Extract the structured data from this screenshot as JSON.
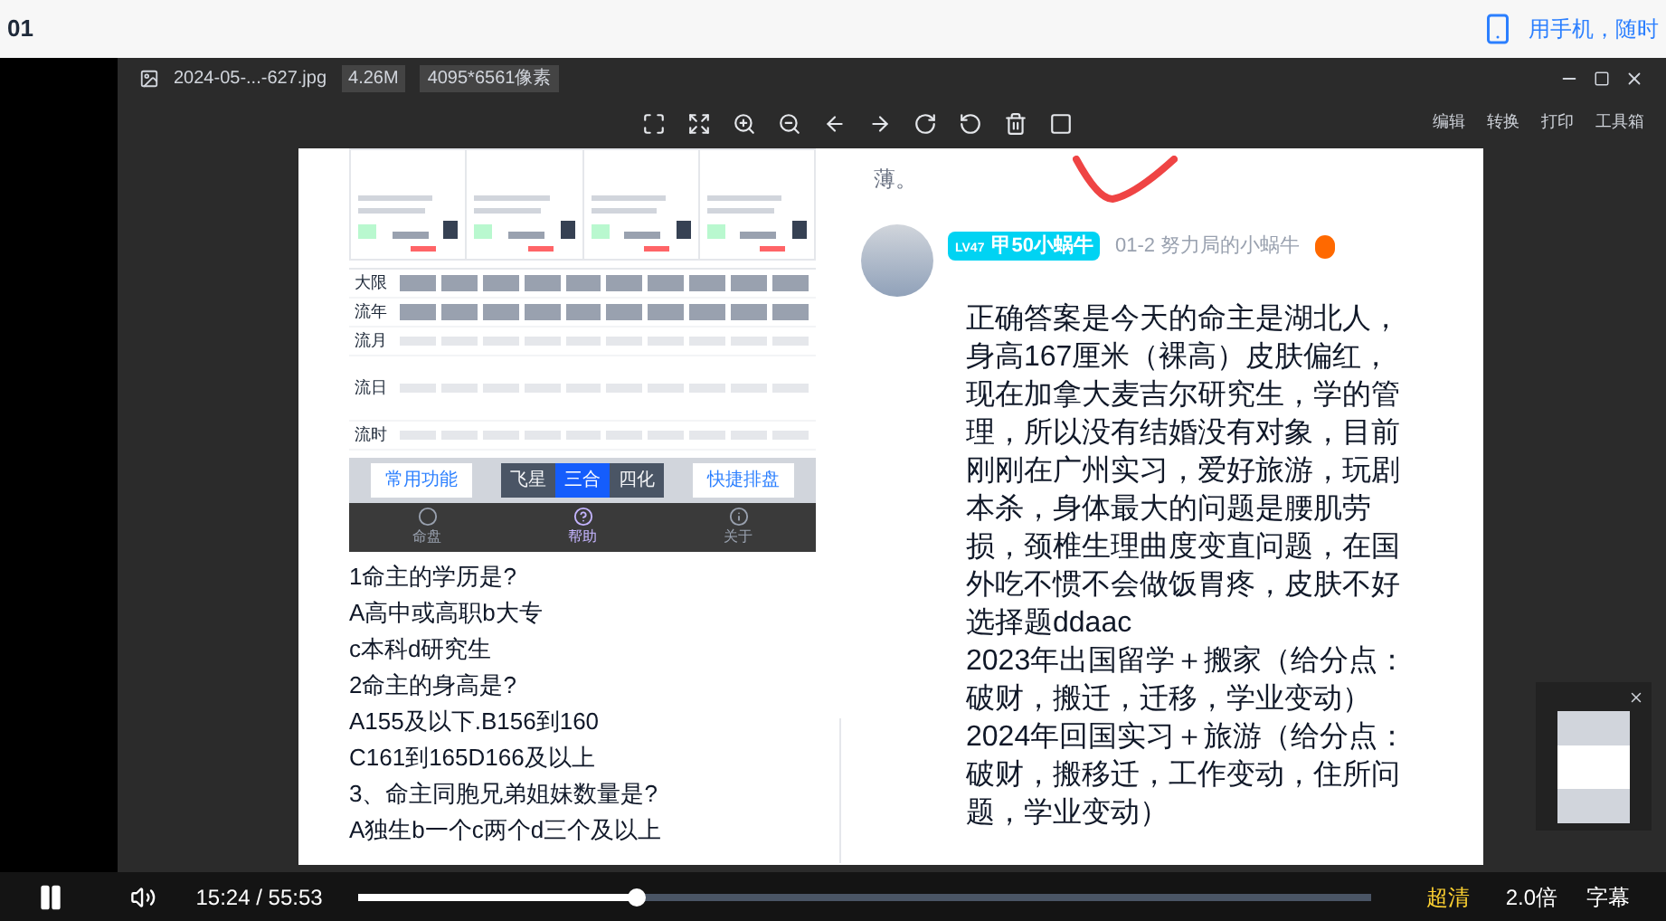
{
  "page": {
    "title": "01",
    "mobile_link": "用手机，随时"
  },
  "viewer": {
    "file_name": "2024-05-...-627.jpg",
    "file_size": "4.26M",
    "dimensions": "4095*6561像素",
    "tools": [
      "编辑",
      "转换",
      "打印",
      "工具箱"
    ]
  },
  "chart_app": {
    "rows": [
      {
        "label": "大限",
        "kind": "filled"
      },
      {
        "label": "流年",
        "kind": "filled"
      },
      {
        "label": "流月",
        "kind": "faint"
      },
      {
        "label": "流日",
        "kind": "tall"
      },
      {
        "label": "流时",
        "kind": "faint"
      }
    ],
    "function_button": "常用功能",
    "modes": [
      {
        "label": "飞星",
        "selected": false
      },
      {
        "label": "三合",
        "selected": true
      },
      {
        "label": "四化",
        "selected": false
      }
    ],
    "quick_button": "快捷排盘",
    "nav": [
      {
        "label": "命盘",
        "selected": false
      },
      {
        "label": "帮助",
        "selected": true
      },
      {
        "label": "关于",
        "selected": false
      }
    ]
  },
  "questions": [
    "1命主的学历是?",
    "A高中或高职b大专",
    "c本科d研究生",
    "2命主的身高是?",
    "A155及以下.B156到160",
    "C161到165D166及以上",
    "3、命主同胞兄弟姐妹数量是?",
    "A独生b一个c两个d三个及以上"
  ],
  "comment": {
    "partial_text": "薄。",
    "badge_level": "LV47",
    "username": "甲50小蜗牛",
    "meta": "01-2 努力局的小蜗牛",
    "paragraphs": [
      "正确答案是今天的命主是湖北人，身高167厘米（裸高）皮肤偏红，现在加拿大麦吉尔研究生，学的管理，所以没有结婚没有对象，目前刚刚在广州实习，爱好旅游，玩剧本杀，身体最大的问题是腰肌劳损，颈椎生理曲度变直问题，在国外吃不惯不会做饭胃疼，皮肤不好",
      "选择题ddaac",
      "2023年出国留学＋搬家（给分点：破财，搬迁，迁移，学业变动）",
      "2024年回国实习＋旅游（给分点：破财，搬移迁，工作变动，住所问题，学业变动）"
    ]
  },
  "player": {
    "playing": true,
    "time": "15:24 / 55:53",
    "level": 0.275,
    "quality": "超清",
    "speed": "2.0倍",
    "subtitles": "字幕"
  }
}
